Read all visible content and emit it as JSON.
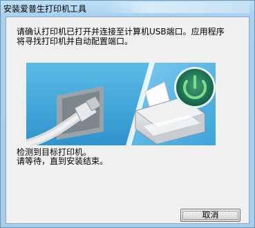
{
  "window": {
    "title": "安装爱普生打印机工具"
  },
  "dialog": {
    "instruction_line1": "请确认打印机已打开并连接至计算机USB端口。应用程序",
    "instruction_line2": "将寻找打印机并自动配置端口。",
    "status_line1": "检测到目标打印机。",
    "status_line2": "请等待，直到安装结束。",
    "cancel_label": "取消"
  },
  "illustration": {
    "icons": [
      "usb-cable-icon",
      "printer-icon",
      "power-icon"
    ],
    "colors": {
      "background": "#3fa8dc",
      "power_ring": "#2f9a5a",
      "power_symbol": "#7fdc8c"
    }
  }
}
